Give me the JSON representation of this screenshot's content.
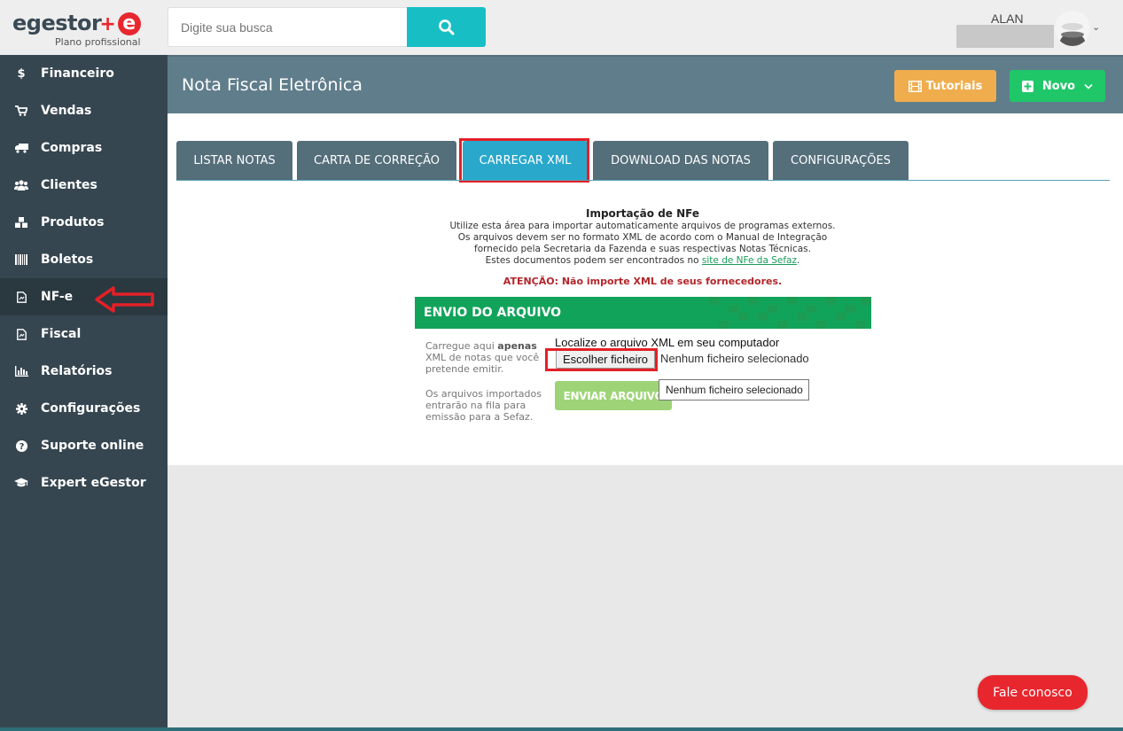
{
  "brand": {
    "name": "egestor",
    "logo_letter": "e",
    "plan": "Plano profissional",
    "accent_color": "#e8262e"
  },
  "search": {
    "placeholder": "Digite sua busca"
  },
  "user": {
    "name": "ALAN"
  },
  "sidebar": {
    "items": [
      {
        "label": "Financeiro",
        "icon": "dollar-icon"
      },
      {
        "label": "Vendas",
        "icon": "cart-icon"
      },
      {
        "label": "Compras",
        "icon": "truck-icon"
      },
      {
        "label": "Clientes",
        "icon": "users-icon"
      },
      {
        "label": "Produtos",
        "icon": "cubes-icon"
      },
      {
        "label": "Boletos",
        "icon": "barcode-icon"
      },
      {
        "label": "NF-e",
        "icon": "document-icon",
        "active": true
      },
      {
        "label": "Fiscal",
        "icon": "document-icon"
      },
      {
        "label": "Relatórios",
        "icon": "bar-chart-icon"
      },
      {
        "label": "Configurações",
        "icon": "gear-icon"
      },
      {
        "label": "Suporte online",
        "icon": "question-icon"
      },
      {
        "label": "Expert eGestor",
        "icon": "graduation-cap-icon"
      }
    ]
  },
  "header": {
    "title": "Nota Fiscal Eletrônica",
    "tutoriais_label": "Tutoriais",
    "novo_label": "Novo"
  },
  "tabs": [
    {
      "label": "LISTAR NOTAS"
    },
    {
      "label": "CARTA DE CORREÇÃO"
    },
    {
      "label": "CARREGAR XML",
      "active": true
    },
    {
      "label": "DOWNLOAD DAS NOTAS"
    },
    {
      "label": "CONFIGURAÇÕES"
    }
  ],
  "import": {
    "title": "Importação de NFe",
    "line1": "Utilize esta área para importar automaticamente arquivos de programas externos.",
    "line2": "Os arquivos devem ser no formato XML de acordo com o Manual de Integração",
    "line3": "fornecido pela Secretaria da Fazenda e suas respectivas Notas Técnicas.",
    "line4_prefix": "Estes documentos podem ser encontrados no ",
    "line4_link": "site de NFe da Sefaz",
    "line4_suffix": ".",
    "attention": "ATENÇÃO: Não importe XML de seus fornecedores."
  },
  "upload": {
    "section_title": "ENVIO DO ARQUIVO",
    "help1_prefix": "Carregue aqui ",
    "help1_bold": "apenas",
    "help1_suffix": " XML de notas que você pretende emitir.",
    "help2": "Os arquivos importados entrarão na fila para emissão para a Sefaz.",
    "locate_label": "Localize o arquivo XML em seu computador",
    "choose_button": "Escolher ficheiro",
    "no_file": "Nenhum ficheiro selecionado",
    "send_button": "ENVIAR ARQUIVO",
    "tooltip": "Nenhum ficheiro selecionado"
  },
  "chat": {
    "label": "Fale conosco"
  },
  "colors": {
    "sidebar": "#364650",
    "header": "#607d8b",
    "tab": "#546e7a",
    "tab_active": "#29a8cc",
    "search_button": "#17bfc4",
    "tutoriais": "#f0ad4e",
    "novo": "#1fc769",
    "envio_bar": "#12a35a",
    "highlight": "#e32027"
  }
}
